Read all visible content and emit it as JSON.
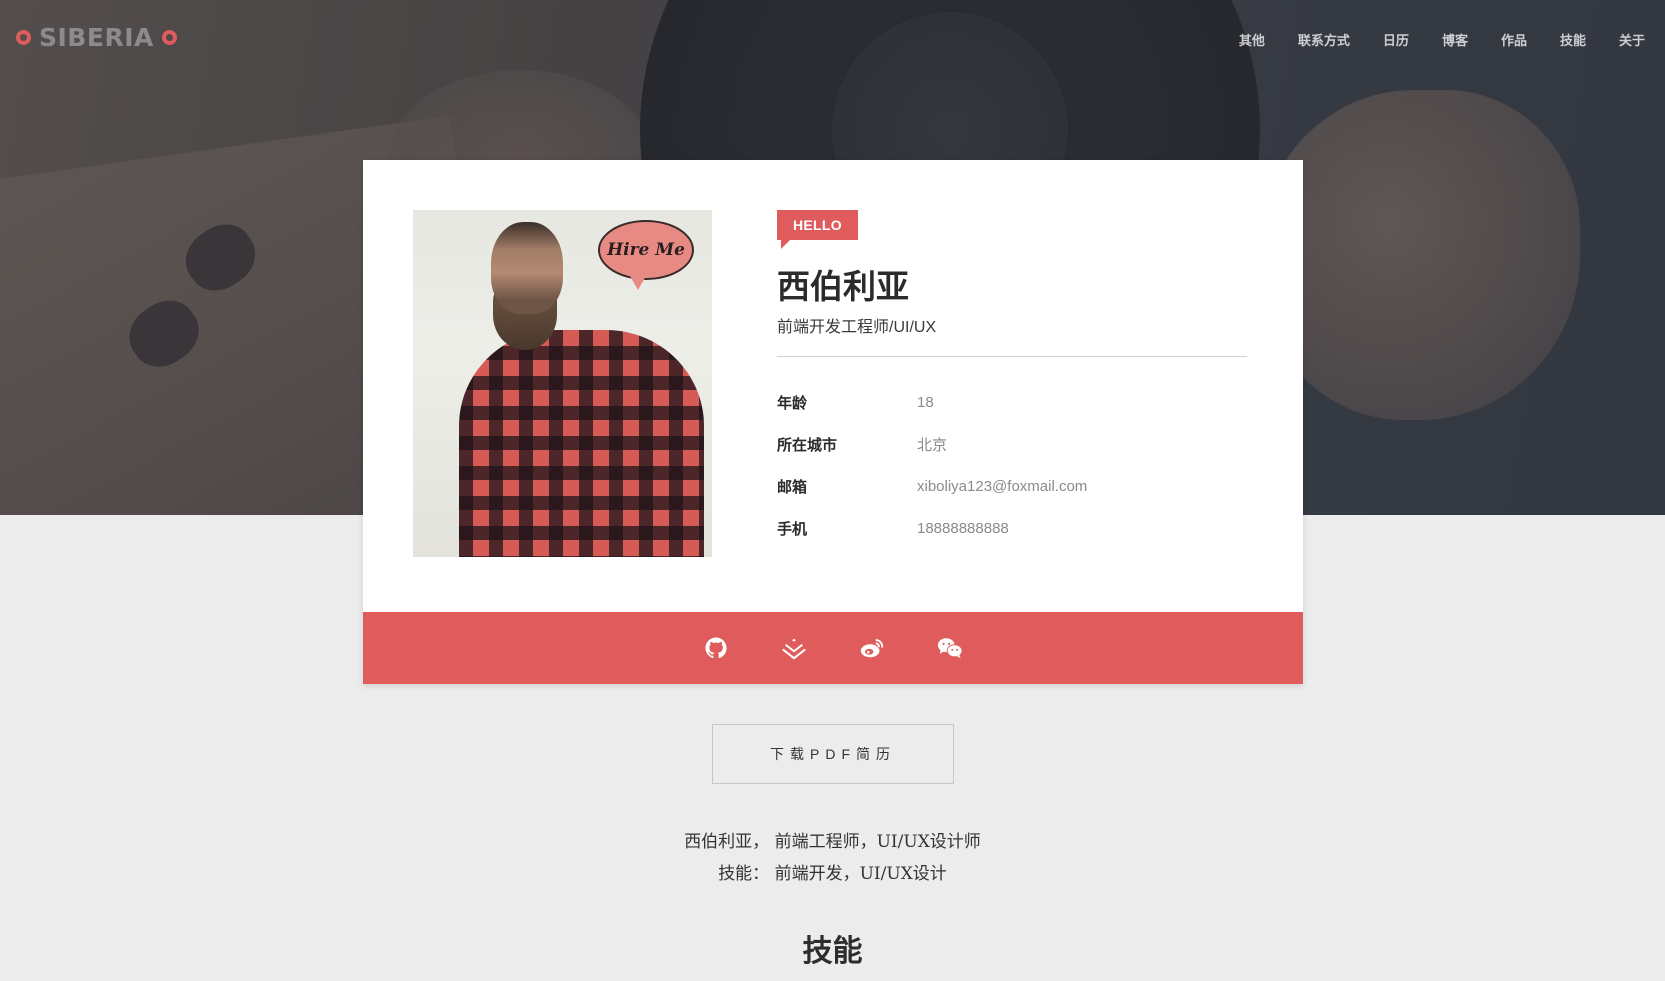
{
  "nav": {
    "logo": "SIBERIA",
    "items": [
      "其他",
      "联系方式",
      "日历",
      "博客",
      "作品",
      "技能",
      "关于"
    ]
  },
  "profile": {
    "photo_bubble": "Hire Me",
    "badge": "HELLO",
    "name": "西伯利亚",
    "role": "前端开发工程师/UI/UX",
    "details": [
      {
        "label": "年龄",
        "value": "18"
      },
      {
        "label": "所在城市",
        "value": "北京"
      },
      {
        "label": "邮箱",
        "value": "xiboliya123@foxmail.com"
      },
      {
        "label": "手机",
        "value": "18888888888"
      }
    ]
  },
  "social": [
    "github-icon",
    "juejin-icon",
    "weibo-icon",
    "wechat-icon"
  ],
  "download_button": "下载PDF简历",
  "description": {
    "line1": "西伯利亚， 前端工程师，UI/UX设计师",
    "line2": "技能： 前端开发，UI/UX设计"
  },
  "section_title": "技能",
  "colors": {
    "accent": "#e05c5c",
    "page_bg": "#ececec",
    "card_bg": "#ffffff"
  }
}
